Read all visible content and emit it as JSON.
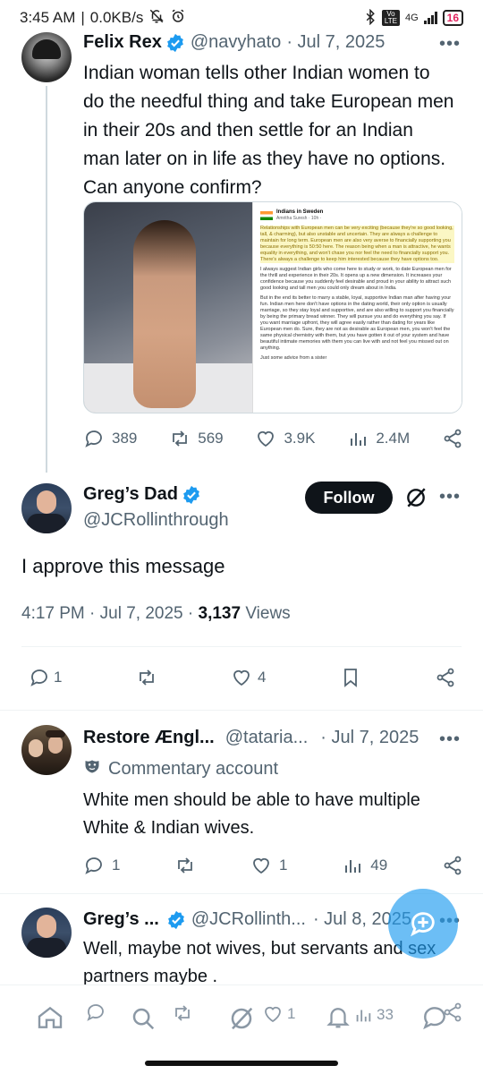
{
  "status_bar": {
    "time": "3:45 AM",
    "net_speed": "0.0KB/s",
    "network": "4G",
    "volte": "Vo LTE",
    "battery": "16"
  },
  "tweet1": {
    "name": "Felix Rex",
    "handle": "@navyhato",
    "date": "· Jul 7, 2025",
    "text": "Indian woman tells other Indian women to do the needful thing and take European men in their 20s and then settle for an Indian man later on in life as they have no options. Can anyone confirm?",
    "embedded_post": {
      "group": "Indians in Sweden",
      "author": "Amritha Suresh · 10h · ",
      "p1": "Relationships with European men can be very exciting (because they're so good looking, tall, & charming), but also unstable and uncertain. They are always a challenge to maintain for long term. European men are also very averse to financially supporting you because everything is 50:50 here. The reason being when a man is attractive, he wants equality in everything, and won't chase you nor feel the need to financially support you. There's always a challenge to keep him interested because they have options too.",
      "p2": "I always suggest Indian girls who come here to study or work, to date European men for the thrill and experience in their 20s. It opens up a new dimension. It increases your confidence because you suddenly feel desirable and proud in your ability to attract such good looking and tall men you could only dream about in India.",
      "p3": "But in the end its better to marry a stable, loyal, supportive Indian man after having your fun. Indian men here don't have options in the dating world, their only option is usually marriage, so they stay loyal and supportive, and are also willing to support you financially by being the primary bread winner. They will pursue you and do everything you say. If you want marriage upfront, they will agree easily rather than dating for years like European men do. Sure, they are not as desirable as European men, you won't feel the same physical chemistry with them, but you have gotten it out of your system and have beautiful intimate memories with them you can live with and not feel you missed out on anything.",
      "p4": "Just some advice from a sister"
    },
    "replies": "389",
    "reposts": "569",
    "likes": "3.9K",
    "views": "2.4M"
  },
  "tweet2": {
    "name": "Greg’s Dad",
    "handle": "@JCRollinthrough",
    "follow_label": "Follow",
    "text": "I approve this message",
    "time": "4:17 PM · Jul 7, 2025 · ",
    "views_count": "3,137",
    "views_label": " Views",
    "replies": "1",
    "likes": "4"
  },
  "reply1": {
    "name": "Restore Ængl...",
    "handle": "@tataria...",
    "date": "· Jul 7, 2025",
    "label": "Commentary account",
    "text": "White men should be able to have multiple White & Indian wives.",
    "replies": "1",
    "likes": "1",
    "views": "49"
  },
  "reply2": {
    "name": "Greg’s ...",
    "handle": "@JCRollinth...",
    "date": "· Jul 8, 2025",
    "text": "Well, maybe not wives, but servants and sex partners maybe .",
    "likes": "1",
    "views": "33"
  },
  "colors": {
    "accent": "#1d9bf0",
    "text": "#0f1419",
    "muted": "#536471"
  }
}
